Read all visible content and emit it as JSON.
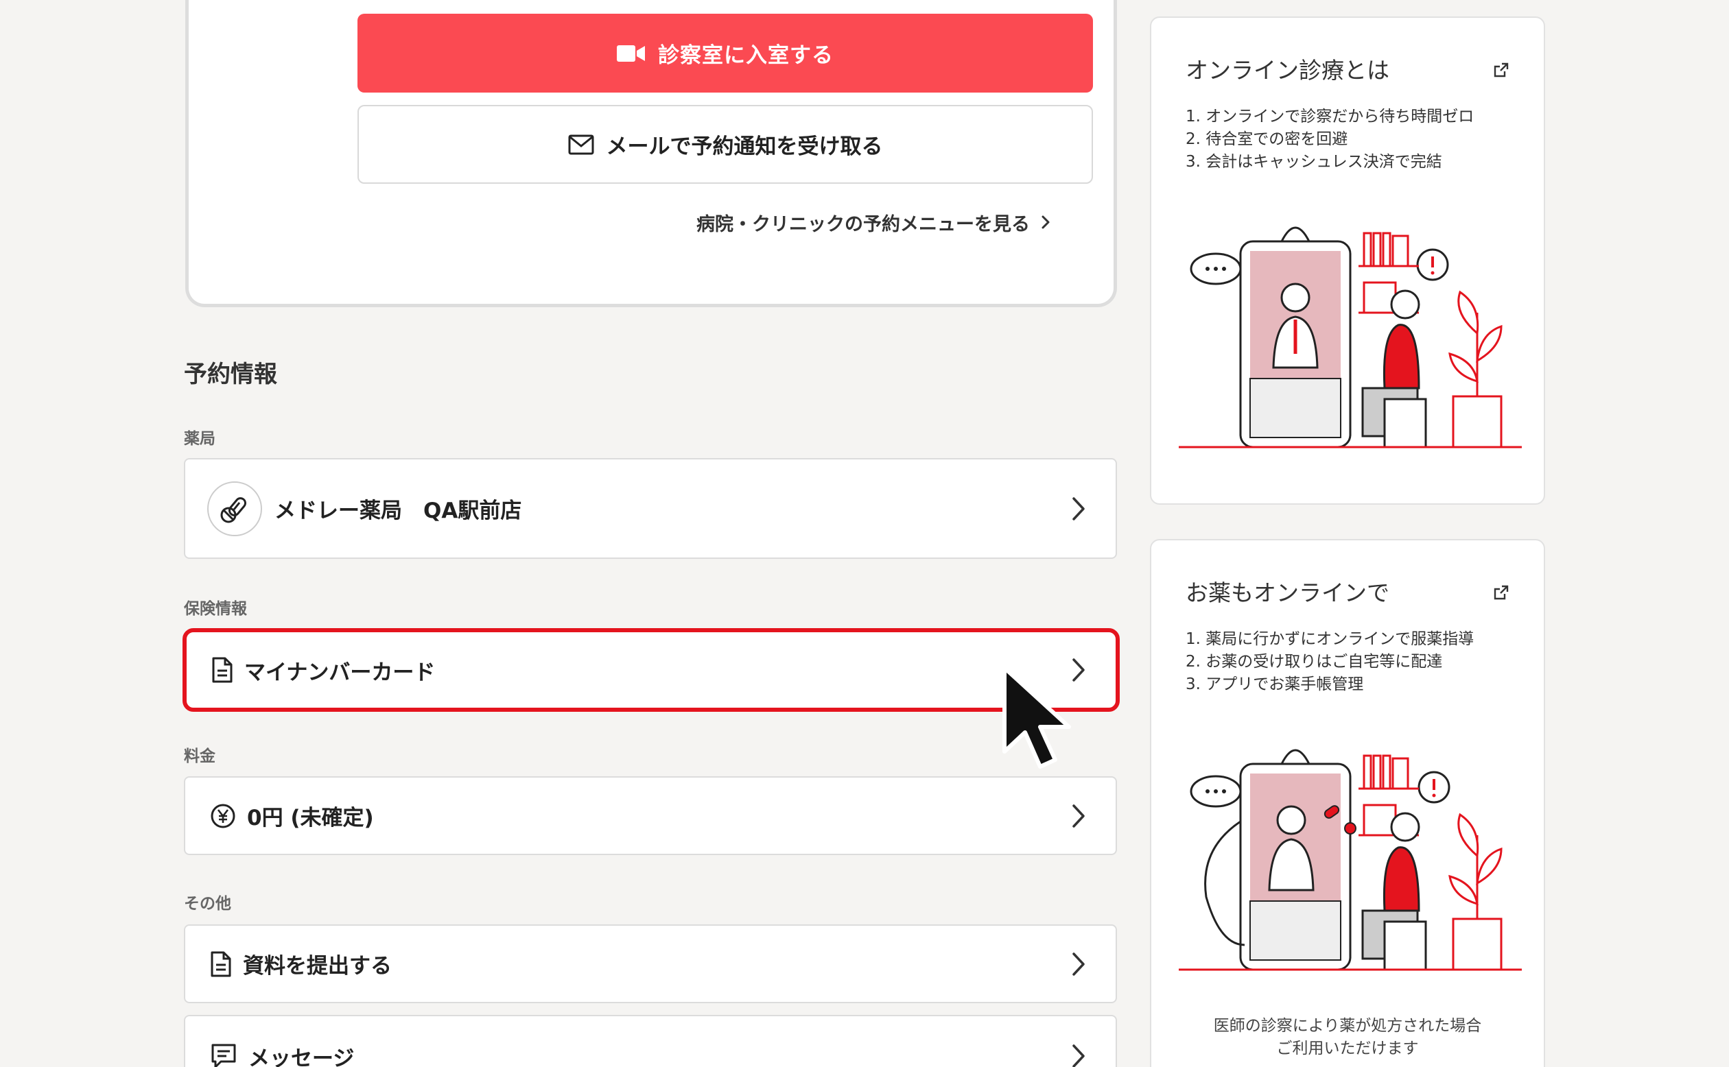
{
  "top_card": {
    "enter_room_label": "診察室に入室する",
    "mail_notify_label": "メールで予約通知を受け取る",
    "clinic_menu_link": "病院・クリニックの予約メニューを見る"
  },
  "reservation": {
    "title": "予約情報",
    "pharmacy": {
      "label": "薬局",
      "value": "メドレー薬局　QA駅前店"
    },
    "insurance": {
      "label": "保険情報",
      "value": "マイナンバーカード"
    },
    "fee": {
      "label": "料金",
      "value": "0円 (未確定)"
    },
    "other": {
      "label": "その他",
      "submit_docs": "資料を提出する",
      "message": "メッセージ"
    }
  },
  "side": {
    "online_care": {
      "title": "オンライン診療とは",
      "items": [
        "1. オンラインで診察だから待ち時間ゼロ",
        "2. 待合室での密を回避",
        "3. 会計はキャッシュレス決済で完結"
      ]
    },
    "online_medicine": {
      "title": "お薬もオンラインで",
      "items": [
        "1. 薬局に行かずにオンラインで服薬指導",
        "2. お薬の受け取りはご自宅等に配達",
        "3. アプリでお薬手帳管理"
      ],
      "note_line1": "医師の診察により薬が処方された場合",
      "note_line2": "ご利用いただけます"
    }
  },
  "icons": {
    "video": "video-camera-icon",
    "mail": "mail-icon",
    "pill": "pill-icon",
    "document": "document-icon",
    "yen": "yen-coin-icon",
    "chat": "chat-bubble-icon",
    "external": "external-link-icon",
    "chevron": "chevron-right-icon"
  },
  "colors": {
    "accent": "#fb4a52",
    "highlight": "#e4141e",
    "background": "#f5f4f2"
  }
}
